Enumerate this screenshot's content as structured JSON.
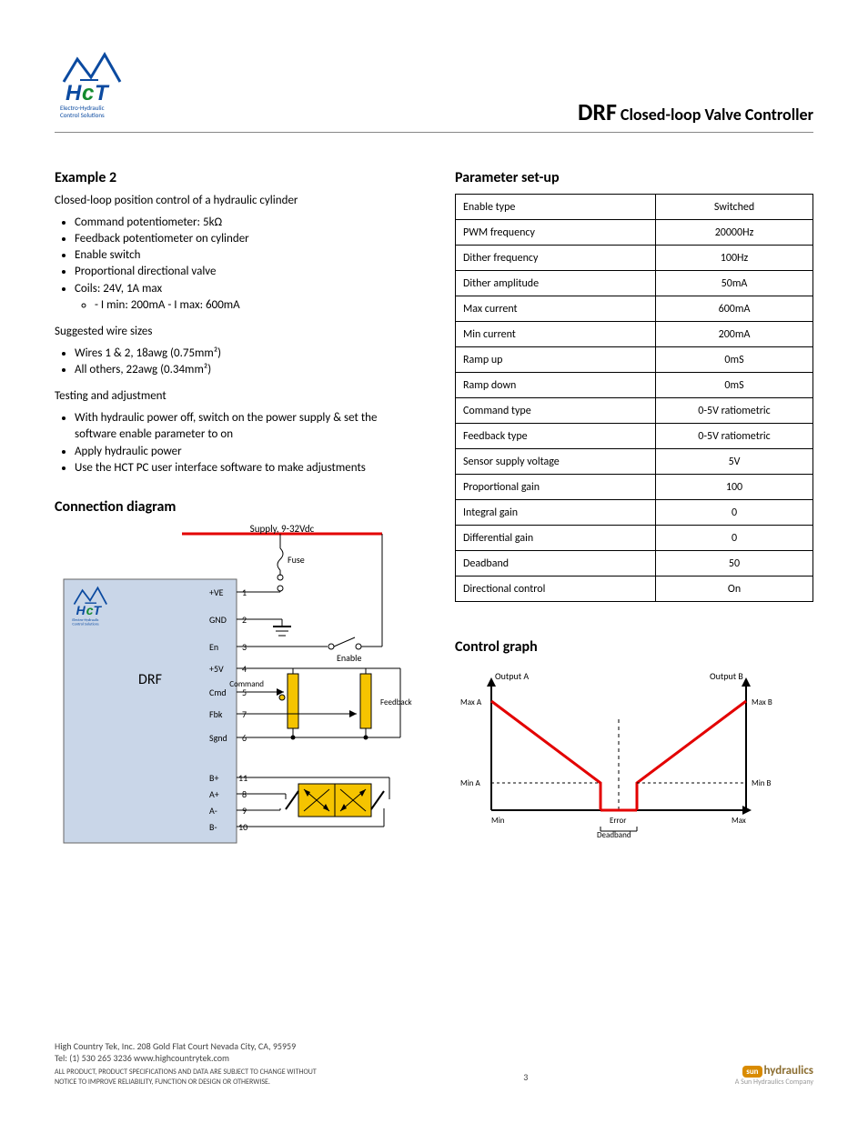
{
  "header": {
    "title_big": "DRF",
    "title_rest": "Closed-loop Valve Controller",
    "logo_top": "HcT",
    "logo_sub1": "Electro-Hydraulic",
    "logo_sub2": "Control Solutions"
  },
  "left": {
    "ex2_title": "Example 2",
    "ex2_para": "Closed-loop position control of a hydraulic cylinder",
    "ex2_items": [
      "Command potentiometer: 5kΩ",
      "Feedback potentiometer on cylinder",
      "Enable switch",
      "Proportional directional valve",
      {
        "text": "Coils: 24V, 1A max",
        "items": [
          "- I min: 200mA - I max: 600mA"
        ]
      }
    ],
    "suggested": "Suggested wire sizes",
    "wires": [
      "Wires 1 & 2, 18awg (0.75mm²)",
      "All others, 22awg (0.34mm²)"
    ],
    "testing": "Testing and adjustment",
    "testing_items": [
      "With hydraulic power off, switch on the power supply & set the software enable parameter to on",
      "Apply hydraulic power",
      "Use the HCT PC user interface software to make adjustments"
    ],
    "conn_title": "Connection diagram"
  },
  "right": {
    "params_title": "Parameter set-up",
    "params": [
      [
        "Enable type",
        "Switched"
      ],
      [
        "PWM frequency",
        "20000Hz"
      ],
      [
        "Dither frequency",
        "100Hz"
      ],
      [
        "Dither amplitude",
        "50mA"
      ],
      [
        "Max current",
        "600mA"
      ],
      [
        "Min current",
        "200mA"
      ],
      [
        "Ramp up",
        "0mS"
      ],
      [
        "Ramp down",
        "0mS"
      ],
      [
        "Command type",
        "0-5V ratiometric"
      ],
      [
        "Feedback type",
        "0-5V ratiometric"
      ],
      [
        "Sensor supply voltage",
        "5V"
      ],
      [
        "Proportional gain",
        "100"
      ],
      [
        "Integral gain",
        "0"
      ],
      [
        "Differential gain",
        "0"
      ],
      [
        "Deadband",
        "50"
      ],
      [
        "Directional control",
        "On"
      ]
    ],
    "graph_title": "Control graph",
    "graph_labels": {
      "y_left": "Output A",
      "y_right": "Output B",
      "y_max_l": "Max A",
      "y_min_l": "Min A",
      "y_max_r": "Max B",
      "y_min_r": "Min B",
      "x_left": "Min",
      "x_mid": "Error",
      "x_right": "Max",
      "db": "Deadband"
    }
  },
  "diagram": {
    "supply": "Supply, 9-32Vdc",
    "pins": {
      "1": "+VE",
      "2": "GND",
      "3": "En",
      "4": "+5V",
      "5": "Cmd",
      "6": "Sgnd",
      "7": "Fbk",
      "8": "A+",
      "9": "A-",
      "10": "B-",
      "11": "B+"
    },
    "parts": {
      "fuse": "Fuse",
      "enable": "Enable",
      "command": "Command",
      "feedback": "Feedback",
      "device": "DRF"
    }
  },
  "footer": {
    "addr1": "High Country Tek, Inc. 208 Gold Flat Court Nevada City, CA, 95959",
    "addr2": "Tel: (1) 530 265 3236 www.highcountrytek.com",
    "page": "3",
    "disclaimer1": "ALL PRODUCT, PRODUCT SPECIFICATIONS AND DATA ARE SUBJECT TO CHANGE WITHOUT",
    "disclaimer2": "NOTICE TO IMPROVE RELIABILITY, FUNCTION OR DESIGN OR OTHERWISE.",
    "sun": "hydraulics",
    "sun_prefix": "sun",
    "sun_sub": "A Sun Hydraulics Company"
  }
}
